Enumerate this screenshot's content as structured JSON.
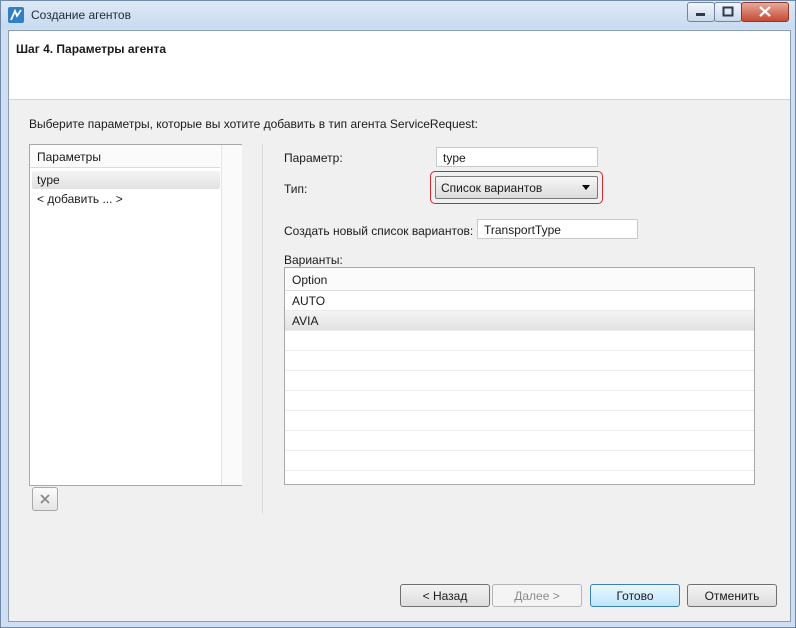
{
  "window": {
    "title": "Создание агентов"
  },
  "header": {
    "step_title": "Шаг 4. Параметры агента"
  },
  "instruction": "Выберите параметры, которые вы хотите добавить в тип агента ServiceRequest:",
  "parameters_list": {
    "header": "Параметры",
    "items": [
      "type",
      "< добавить ... >"
    ],
    "selected_index": 0
  },
  "form": {
    "parameter_label": "Параметр:",
    "parameter_value": "type",
    "type_label": "Тип:",
    "type_value": "Список вариантов",
    "new_list_label": "Создать новый список вариантов:",
    "new_list_value": "TransportType",
    "variants_label": "Варианты:"
  },
  "variants_table": {
    "column": "Option",
    "rows": [
      "AUTO",
      "AVIA"
    ],
    "selected_index": 1
  },
  "buttons": {
    "back": "< Назад",
    "next": "Далее >",
    "finish": "Готово",
    "cancel": "Отменить"
  },
  "colors": {
    "highlight_border": "#d0282a",
    "primary_button": "#bee6fd"
  },
  "icons": {
    "app": "anylogic-icon",
    "delete": "delete-icon"
  }
}
